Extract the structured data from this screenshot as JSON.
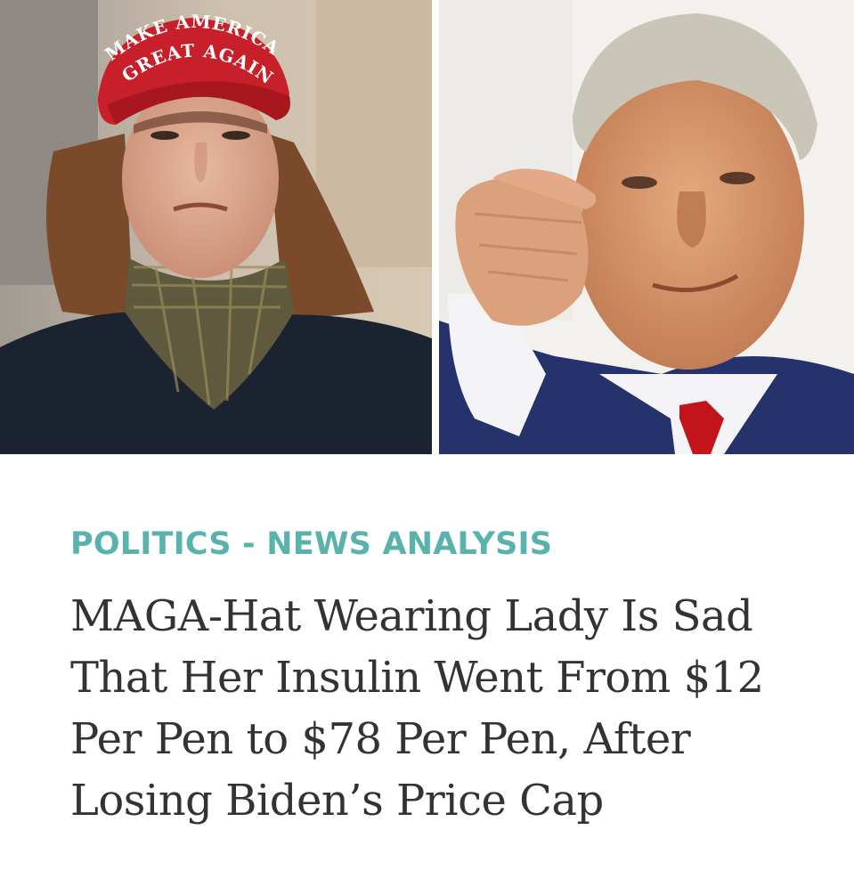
{
  "photos": {
    "left": {
      "hat_text_line1": "MAKE AMERICA",
      "hat_text_line2": "GREAT AGAIN",
      "hat_color": "#c8202b",
      "scarf_color": "#5f5a3e",
      "coat_color": "#1b2230"
    },
    "right": {
      "suit_color": "#25326b",
      "tie_color": "#c4141b",
      "shirt_color": "#f4f4f6"
    }
  },
  "article": {
    "category": "POLITICS - NEWS ANALYSIS",
    "headline": "MAGA-Hat Wearing Lady Is Sad That Her Insulin Went From $12 Per Pen to $78 Per Pen, After Losing Biden’s Price Cap"
  },
  "colors": {
    "category_text": "#59b3ac",
    "headline_text": "#333333",
    "background": "#ffffff"
  }
}
